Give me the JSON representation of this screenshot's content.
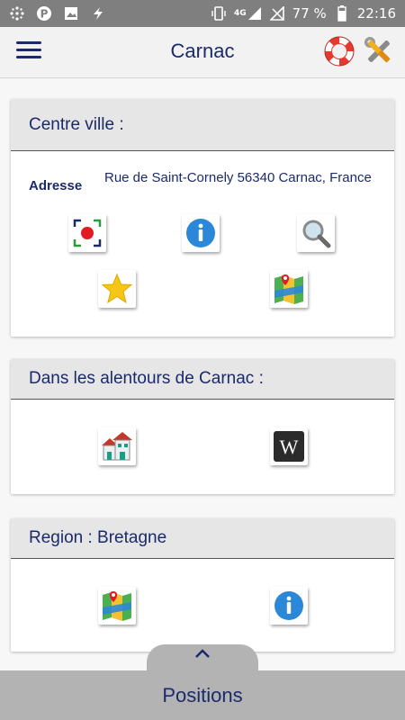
{
  "status_bar": {
    "network": "4G",
    "battery": "77 %",
    "time": "22:16"
  },
  "app_bar": {
    "title": "Carnac",
    "menu_icon": "hamburger-menu-icon",
    "help_icon": "lifebuoy-icon",
    "settings_icon": "tools-icon"
  },
  "centre_ville": {
    "header": "Centre ville :",
    "address_label": "Adresse",
    "address_value": "Rue de Saint-Cornely 56340 Carnac, France",
    "buttons": [
      "camera-scan-icon",
      "info-icon",
      "search-icon",
      "star-icon",
      "map-icon"
    ]
  },
  "alentours": {
    "header": "Dans les alentours de Carnac :",
    "buttons": [
      "houses-icon",
      "wikipedia-icon"
    ]
  },
  "region": {
    "header": "Region : Bretagne",
    "buttons": [
      "map-icon",
      "info-icon"
    ]
  },
  "bottom_sheet": {
    "label": "Positions",
    "toggle_icon": "chevron-up-icon"
  },
  "colors": {
    "accent": "#1b2a6b",
    "status_bar": "#7f7f7f",
    "card_header": "#e6e6e6",
    "sheet": "#b3b3b3"
  }
}
